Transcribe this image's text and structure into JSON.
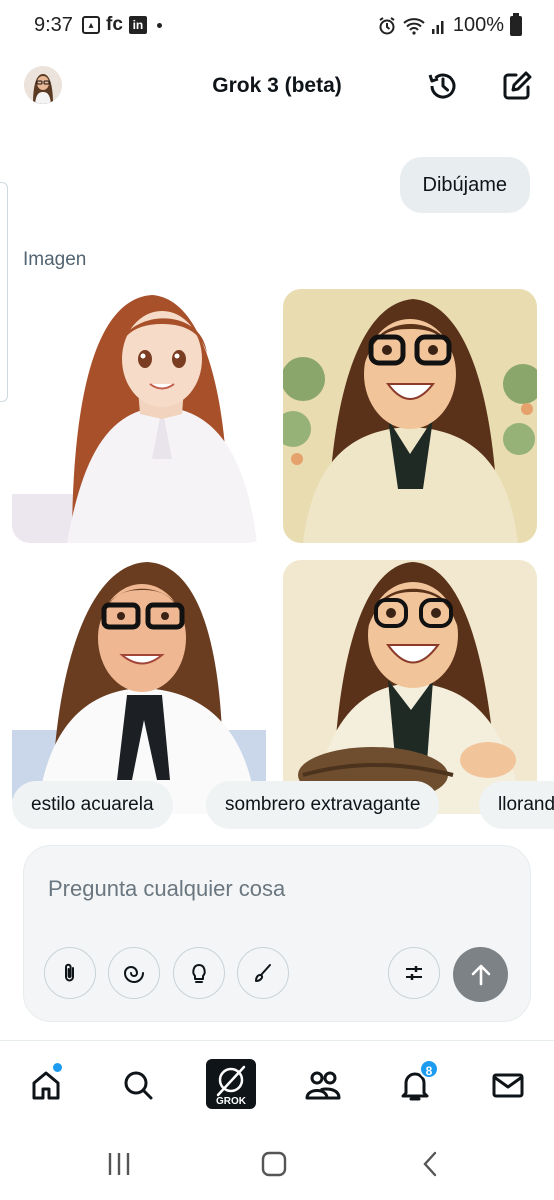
{
  "status_bar": {
    "time": "9:37",
    "notif_text": "fc",
    "linkedin_text": "in",
    "battery_text": "100%"
  },
  "header": {
    "title": "Grok 3 (beta)",
    "icons": [
      "history-icon",
      "new-chat-icon"
    ]
  },
  "chat": {
    "user_message": "Dibújame",
    "section_label": "Imagen",
    "images": [
      {
        "hair": "#a8502a",
        "bg": "#ffffff",
        "style": "anime"
      },
      {
        "hair": "#5a3119",
        "bg": "#e8dcb0",
        "style": "cartoon-glasses"
      },
      {
        "hair": "#6b3d20",
        "bg": "#ffffff",
        "style": "3d-glasses"
      },
      {
        "hair": "#5a3119",
        "bg": "#f1e8cf",
        "style": "cartoon-glasses-basket"
      }
    ]
  },
  "suggestions": [
    "estilo acuarela",
    "sombrero extravagante",
    "llorando"
  ],
  "composer": {
    "placeholder": "Pregunta cualquier cosa",
    "tools": [
      "attach-icon",
      "deepsearch-icon",
      "think-icon",
      "draw-icon"
    ]
  },
  "bottom_nav": {
    "grok_label": "GROK",
    "notifications_badge": "8",
    "accent": "#1d9bf0"
  }
}
